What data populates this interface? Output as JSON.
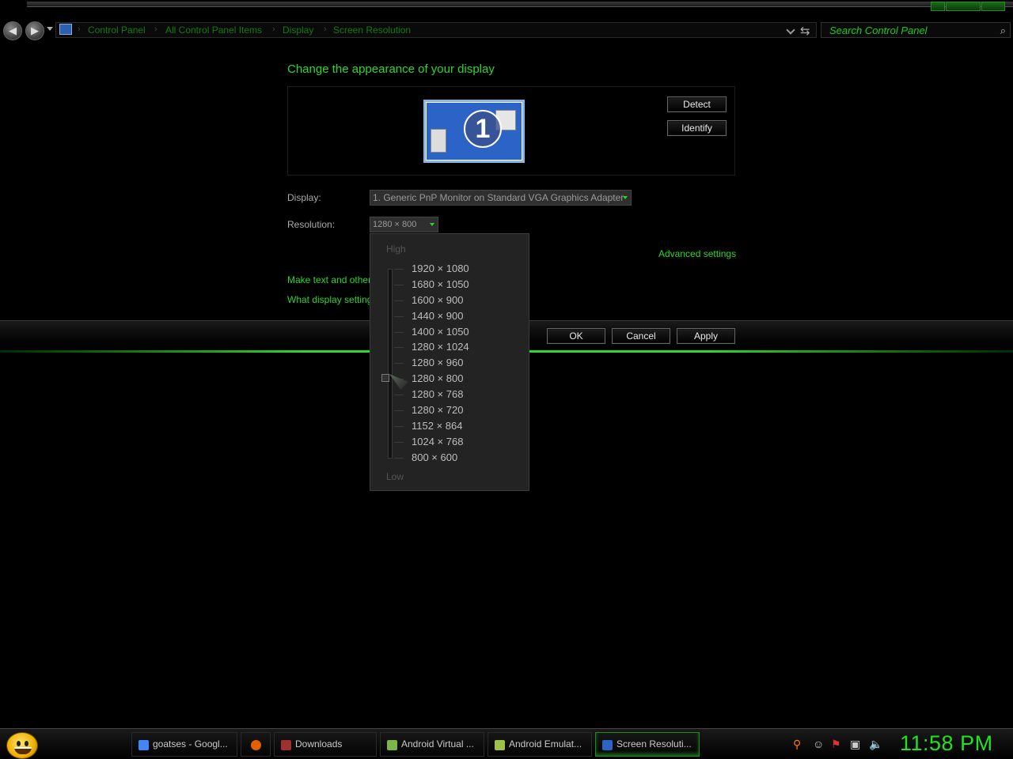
{
  "window": {
    "title": "Screen Resolution"
  },
  "nav": {
    "back_glyph": "◀",
    "forward_glyph": "▶",
    "breadcrumbs": [
      "Control Panel",
      "All Control Panel Items",
      "Display",
      "Screen Resolution"
    ],
    "separator": "›",
    "refresh_glyph": "⇆",
    "search_placeholder": "Search Control Panel",
    "search_glyph": "⌕"
  },
  "main": {
    "title": "Change the appearance of your display",
    "monitor_number": "1",
    "detect_label": "Detect",
    "identify_label": "Identify",
    "display_label": "Display:",
    "display_value": "1. Generic PnP Monitor on Standard VGA Graphics Adapter",
    "resolution_label": "Resolution:",
    "resolution_value": "1280 × 800",
    "advanced_link": "Advanced settings",
    "text_size_link": "Make text and other",
    "help_link": "What display setting"
  },
  "buttons": {
    "ok": "OK",
    "cancel": "Cancel",
    "apply": "Apply"
  },
  "resolution_dropdown": {
    "high_label": "High",
    "low_label": "Low",
    "options": [
      "1920 × 1080",
      "1680 × 1050",
      "1600 × 900",
      "1440 × 900",
      "1400 × 1050",
      "1280 × 1024",
      "1280 × 960",
      "1280 × 800",
      "1280 × 768",
      "1280 × 720",
      "1152 × 864",
      "1024 × 768",
      "800 × 600"
    ],
    "selected": "1280 × 800"
  },
  "taskbar": {
    "tasks": [
      {
        "label": "goatses - Googl...",
        "icon": "chrome-icon",
        "color": "#4285f4"
      },
      {
        "label": "",
        "icon": "firefox-icon",
        "color": "#e66000"
      },
      {
        "label": "Downloads",
        "icon": "downloads-icon",
        "color": "#a03030"
      },
      {
        "label": "Android Virtual ...",
        "icon": "android-sdk-icon",
        "color": "#7ab648"
      },
      {
        "label": "Android Emulat...",
        "icon": "android-emulator-icon",
        "color": "#9cc24a"
      },
      {
        "label": "Screen Resoluti...",
        "icon": "display-icon",
        "color": "#2b63c6"
      }
    ],
    "clock": "11:58 PM"
  },
  "colors": {
    "accent": "#2dd62d",
    "background": "#000000"
  }
}
